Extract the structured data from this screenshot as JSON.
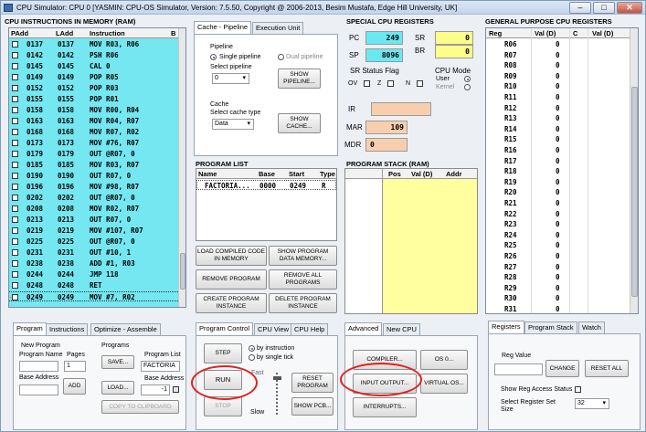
{
  "window": {
    "title": "CPU Simulator: CPU 0    [YASMIN: CPU-OS Simulator,  Version: 7.5.50,  Copyright @ 2006-2013, Besim Mustafa, Edge Hill University, UK]"
  },
  "memory": {
    "title": "CPU INSTRUCTIONS IN MEMORY (RAM)",
    "headers": [
      "PAdd",
      "LAdd",
      "Instruction",
      "B"
    ],
    "rows": [
      {
        "padd": "0137",
        "ladd": "0137",
        "ins": "MOV R03, R06"
      },
      {
        "padd": "0142",
        "ladd": "0142",
        "ins": "PSH R06"
      },
      {
        "padd": "0145",
        "ladd": "0145",
        "ins": "CAL 0"
      },
      {
        "padd": "0149",
        "ladd": "0149",
        "ins": "POP R05"
      },
      {
        "padd": "0152",
        "ladd": "0152",
        "ins": "POP R03"
      },
      {
        "padd": "0155",
        "ladd": "0155",
        "ins": "POP R01"
      },
      {
        "padd": "0158",
        "ladd": "0158",
        "ins": "MOV R00, R04"
      },
      {
        "padd": "0163",
        "ladd": "0163",
        "ins": "MOV R04, R07"
      },
      {
        "padd": "0168",
        "ladd": "0168",
        "ins": "MOV R07, R02"
      },
      {
        "padd": "0173",
        "ladd": "0173",
        "ins": "MOV #76, R07"
      },
      {
        "padd": "0179",
        "ladd": "0179",
        "ins": "OUT @R07, 0"
      },
      {
        "padd": "0185",
        "ladd": "0185",
        "ins": "MOV R03, R07"
      },
      {
        "padd": "0190",
        "ladd": "0190",
        "ins": "OUT R07, 0"
      },
      {
        "padd": "0196",
        "ladd": "0196",
        "ins": "MOV #98, R07"
      },
      {
        "padd": "0202",
        "ladd": "0202",
        "ins": "OUT @R07, 0"
      },
      {
        "padd": "0208",
        "ladd": "0208",
        "ins": "MOV R02, R07"
      },
      {
        "padd": "0213",
        "ladd": "0213",
        "ins": "OUT R07, 0"
      },
      {
        "padd": "0219",
        "ladd": "0219",
        "ins": "MOV #107, R07"
      },
      {
        "padd": "0225",
        "ladd": "0225",
        "ins": "OUT @R07, 0"
      },
      {
        "padd": "0231",
        "ladd": "0231",
        "ins": "OUT #10, 1"
      },
      {
        "padd": "0238",
        "ladd": "0238",
        "ins": "ADD #1, R03"
      },
      {
        "padd": "0244",
        "ladd": "0244",
        "ins": "JMP 118"
      },
      {
        "padd": "0248",
        "ladd": "0248",
        "ins": "RET"
      },
      {
        "padd": "0249",
        "ladd": "0249",
        "ins": "MOV #7, R02",
        "current": true
      }
    ]
  },
  "cache_tabs": [
    "Cache - Pipeline",
    "Execution Unit"
  ],
  "pipeline": {
    "group": "Pipeline",
    "single": "Single pipeline",
    "dual": "Dual pipeline",
    "select_label": "Select pipeline",
    "select_value": "0",
    "show_button": "SHOW\nPIPELINE..."
  },
  "cache": {
    "group": "Cache",
    "select_label": "Select cache type",
    "select_value": "Data",
    "show_button": "SHOW\nCACHE..."
  },
  "special_registers": {
    "title": "SPECIAL CPU REGISTERS",
    "pc": {
      "label": "PC",
      "value": "249"
    },
    "sp": {
      "label": "SP",
      "value": "8096"
    },
    "sr": {
      "label": "SR",
      "value": "0"
    },
    "br": {
      "label": "BR",
      "value": "0"
    },
    "status_title": "SR Status Flag",
    "flags": [
      "OV",
      "Z",
      "N"
    ],
    "mode_title": "CPU Mode",
    "mode_user": "User",
    "mode_kernel": "Kernel",
    "ir": {
      "label": "IR",
      "value": ""
    },
    "mar": {
      "label": "MAR",
      "value": "109"
    },
    "mdr": {
      "label": "MDR",
      "value": "0"
    }
  },
  "gp_registers": {
    "title": "GENERAL PURPOSE CPU REGISTERS",
    "headers": [
      "Reg",
      "Val (D)",
      "C",
      "Val (D)"
    ],
    "rows": [
      {
        "reg": "R06",
        "val": "0"
      },
      {
        "reg": "R07",
        "val": "0"
      },
      {
        "reg": "R08",
        "val": "0"
      },
      {
        "reg": "R09",
        "val": "0"
      },
      {
        "reg": "R10",
        "val": "0"
      },
      {
        "reg": "R11",
        "val": "0"
      },
      {
        "reg": "R12",
        "val": "0"
      },
      {
        "reg": "R13",
        "val": "0"
      },
      {
        "reg": "R14",
        "val": "0"
      },
      {
        "reg": "R15",
        "val": "0"
      },
      {
        "reg": "R16",
        "val": "0"
      },
      {
        "reg": "R17",
        "val": "0"
      },
      {
        "reg": "R18",
        "val": "0"
      },
      {
        "reg": "R19",
        "val": "0"
      },
      {
        "reg": "R20",
        "val": "0"
      },
      {
        "reg": "R21",
        "val": "0"
      },
      {
        "reg": "R22",
        "val": "0"
      },
      {
        "reg": "R23",
        "val": "0"
      },
      {
        "reg": "R24",
        "val": "0"
      },
      {
        "reg": "R25",
        "val": "0"
      },
      {
        "reg": "R26",
        "val": "0"
      },
      {
        "reg": "R27",
        "val": "0"
      },
      {
        "reg": "R28",
        "val": "0"
      },
      {
        "reg": "R29",
        "val": "0"
      },
      {
        "reg": "R30",
        "val": "0"
      },
      {
        "reg": "R31",
        "val": "0"
      }
    ]
  },
  "program_list": {
    "title": "PROGRAM LIST",
    "headers": [
      "Name",
      "Base",
      "Start",
      "Type"
    ],
    "row": {
      "name": "FACTORIA...",
      "base": "0000",
      "start": "0249",
      "type": "R"
    }
  },
  "program_stack": {
    "title": "PROGRAM STACK (RAM)",
    "headers": [
      "Pos",
      "Val (D)",
      "Addr"
    ]
  },
  "program_buttons": {
    "load_compiled": "LOAD COMPILED CODE\nIN MEMORY",
    "show_data_memory": "SHOW PROGRAM\nDATA MEMORY...",
    "remove_program": "REMOVE PROGRAM",
    "remove_all": "REMOVE ALL\nPROGRAMS",
    "create_instance": "CREATE PROGRAM\nINSTANCE",
    "delete_instance": "DELETE PROGRAM\nINSTANCE"
  },
  "left_tabs": [
    "Program",
    "Instructions",
    "Optimize - Assemble"
  ],
  "program_panel": {
    "new_program": "New Program",
    "program_name": "Program Name",
    "pages": "Pages",
    "pages_value": "1",
    "base_address": "Base Address",
    "add": "ADD",
    "programs": "Programs",
    "save": "SAVE...",
    "load": "LOAD...",
    "program_list_label": "Program List",
    "program_list_value": "FACTORIA",
    "base_address2": "Base Address",
    "base_address2_value": "-1",
    "copy": "COPY TO CLIPBOARD"
  },
  "control_tabs": [
    "Program Control",
    "CPU View",
    "CPU Help"
  ],
  "control": {
    "step": "STEP",
    "run": "RUN",
    "stop": "STOP",
    "by_instruction": "by instruction",
    "by_tick": "by single tick",
    "fast": "Fast",
    "slow": "Slow",
    "reset_program": "RESET\nPROGRAM",
    "show_pcb": "SHOW PCB..."
  },
  "advanced_tabs": [
    "Advanced",
    "New CPU"
  ],
  "advanced": {
    "compiler": "COMPILER...",
    "os": "OS 0...",
    "io": "INPUT OUTPUT...",
    "virtual_os": "VIRTUAL OS...",
    "interrupts": "INTERRUPTS..."
  },
  "right_tabs": [
    "Registers",
    "Program Stack",
    "Watch"
  ],
  "registers_panel": {
    "reg_value": "Reg Value",
    "change": "CHANGE",
    "reset_all": "RESET ALL",
    "show_access": "Show Reg Access Status",
    "select_set": "Select Register Set",
    "size": "Size",
    "select_value": "32"
  },
  "colors": {
    "memory_bg": "#74e7f0",
    "register_cyan": "#6ae8f2",
    "register_yellow": "#fdfd8c",
    "ir_peach": "#f8cfae",
    "stack_yellow": "#ffffa0",
    "highlight_red": "#e0221f"
  }
}
